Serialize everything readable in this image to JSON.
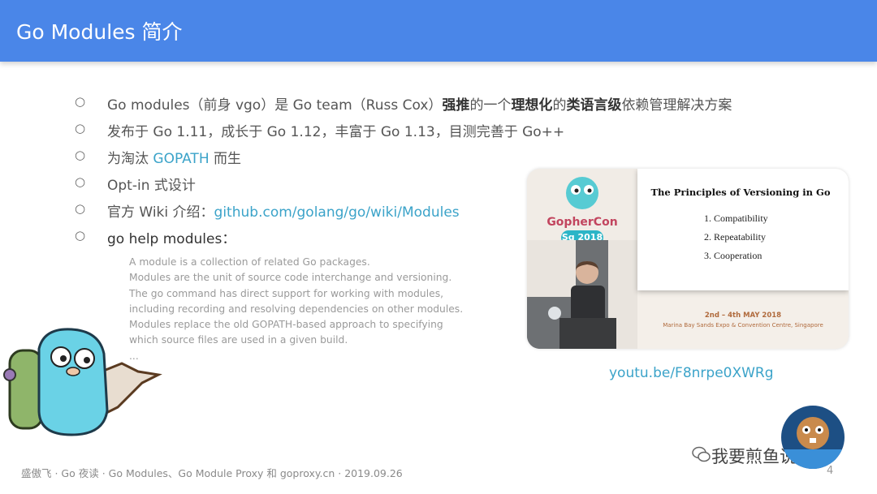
{
  "header": {
    "title": "Go Modules 简介"
  },
  "bullets": [
    {
      "parts": [
        {
          "text": "Go modules（前身 vgo）是 Go team（Russ Cox）",
          "style": ""
        },
        {
          "text": "强推",
          "style": "bold"
        },
        {
          "text": "的一个",
          "style": ""
        },
        {
          "text": "理想化",
          "style": "bold"
        },
        {
          "text": "的",
          "style": ""
        },
        {
          "text": "类语言级",
          "style": "bold"
        },
        {
          "text": "依赖管理解决方案",
          "style": ""
        }
      ]
    },
    {
      "parts": [
        {
          "text": "发布于 Go 1.11，成长于 Go 1.12，丰富于 Go 1.13，目测完善于 Go++",
          "style": ""
        }
      ]
    },
    {
      "parts": [
        {
          "text": "为淘汰 ",
          "style": ""
        },
        {
          "text": "GOPATH",
          "style": "link"
        },
        {
          "text": " 而生",
          "style": ""
        }
      ]
    },
    {
      "parts": [
        {
          "text": "Opt-in 式设计",
          "style": ""
        }
      ]
    },
    {
      "parts": [
        {
          "text": "官方 Wiki 介绍：",
          "style": ""
        },
        {
          "text": "github.com/golang/go/wiki/Modules",
          "style": "link"
        }
      ]
    },
    {
      "parts": [
        {
          "text": "go help modules：",
          "style": "dark"
        }
      ]
    }
  ],
  "bullet_marker": "○",
  "help_text": [
    "A module is a collection of related Go packages.",
    "Modules are the unit of source code interchange and versioning.",
    "The go command has direct support for working with modules,",
    "including recording and resolving dependencies on other modules.",
    "Modules replace the old GOPATH-based approach to specifying",
    "which source files are used in a given build.",
    "..."
  ],
  "video": {
    "brand_line1": "GopherCon",
    "brand_line2": "Sg 2018",
    "panel_title": "The Principles of Versioning in Go",
    "principles": [
      "1.   Compatibility",
      "2.   Repeatability",
      "3.   Cooperation"
    ],
    "dates": "2nd – 4th MAY 2018",
    "venue": "Marina Bay Sands Expo & Convention Centre, Singapore",
    "link": "youtu.be/F8nrpe0XWRg"
  },
  "footer": {
    "text": "盛傲飞 · Go 夜读 · Go Modules、Go Module Proxy 和 goproxy.cn · 2019.09.26",
    "page_number": "4"
  },
  "watermark": {
    "text": "我要煎鱼说"
  },
  "colors": {
    "header": "#4a86e8",
    "link": "#3ba3c9",
    "body_text": "#555555"
  }
}
